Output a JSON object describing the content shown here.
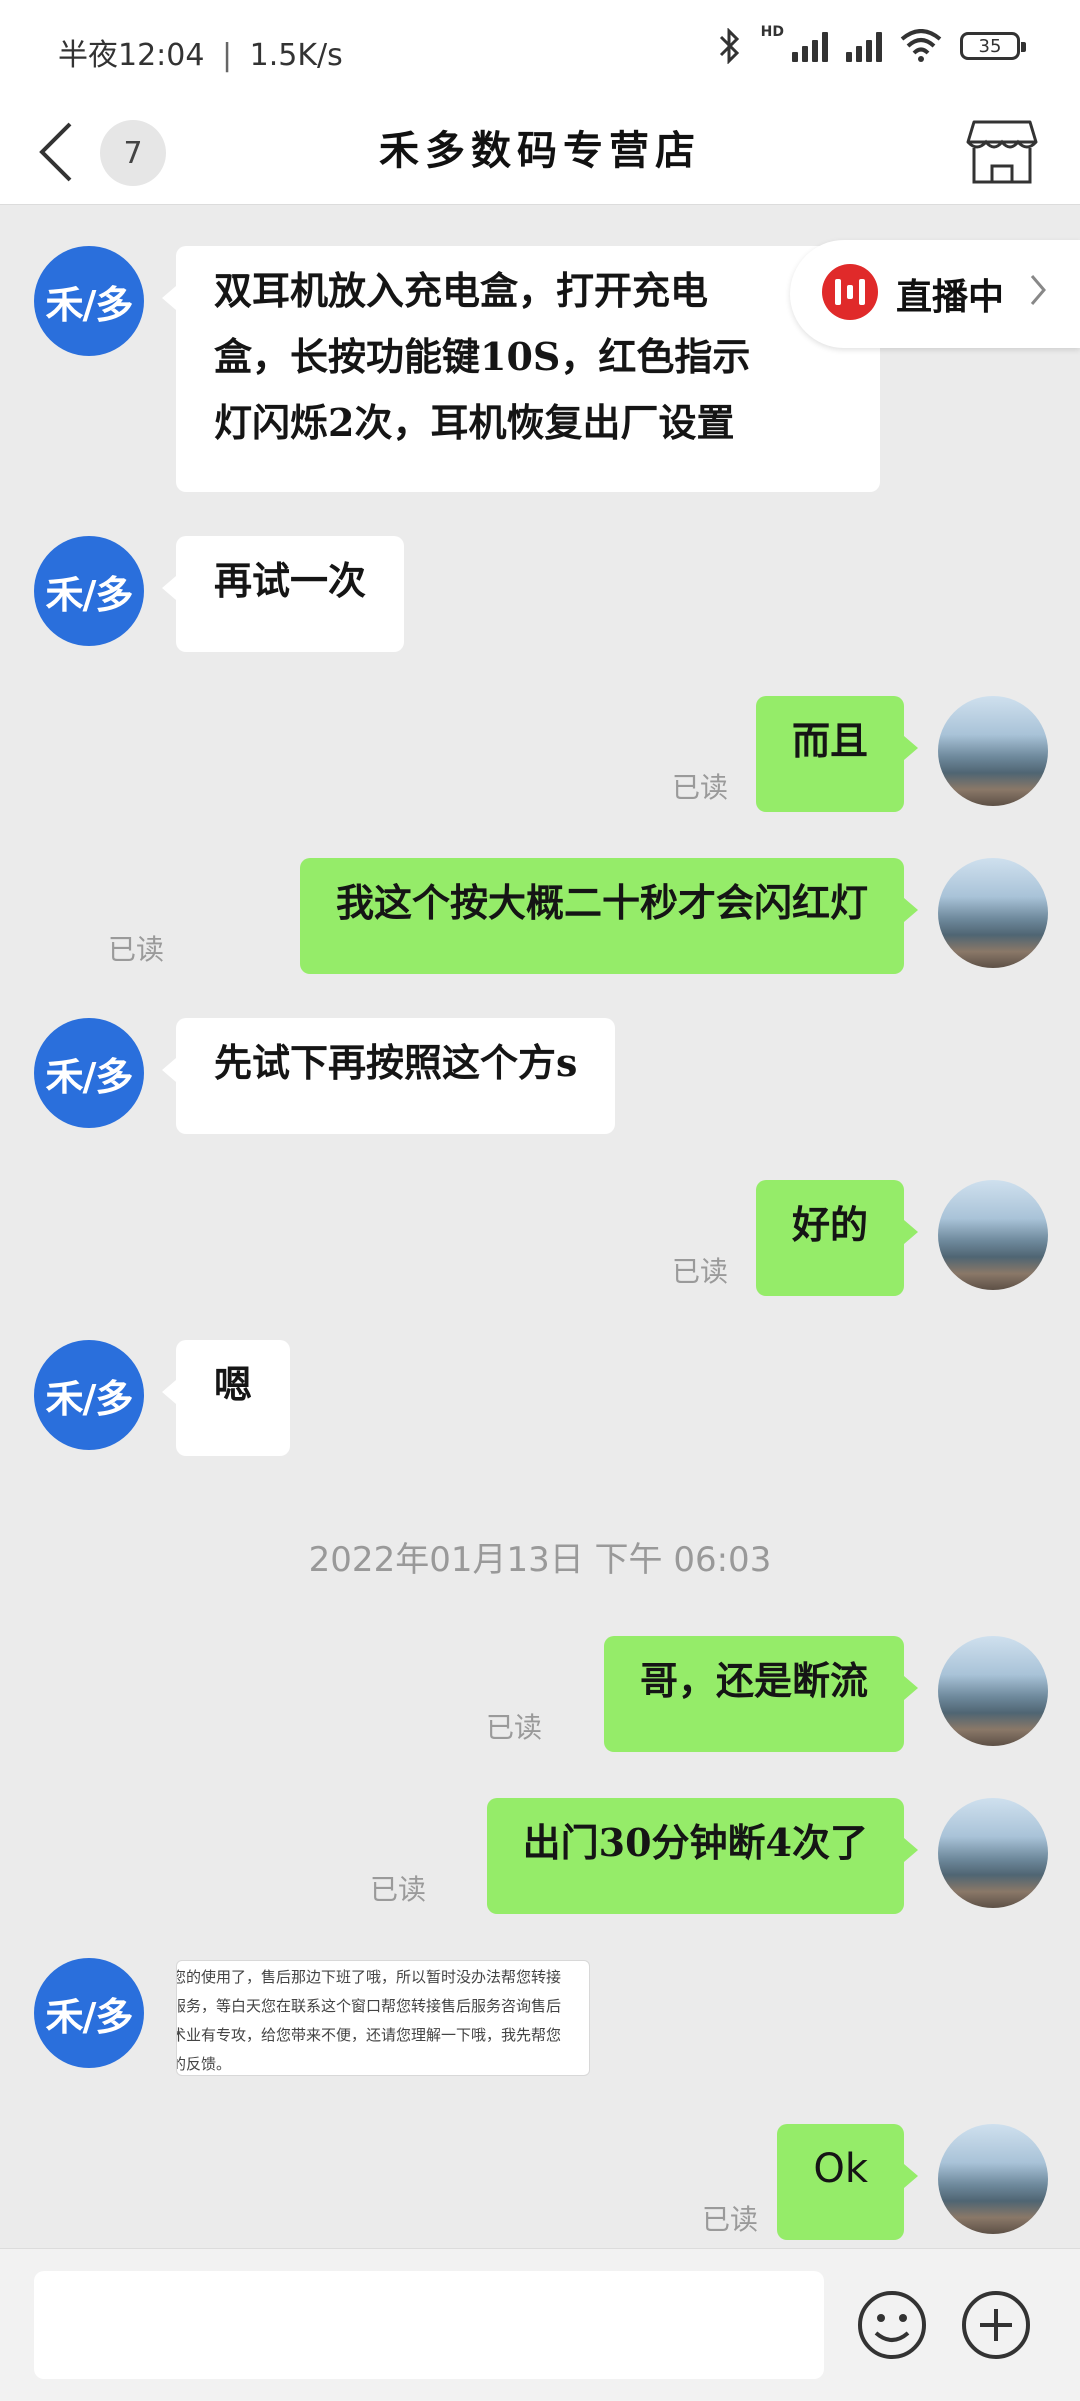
{
  "status_bar": {
    "time": "半夜12:04",
    "speed": "1.5K/s",
    "battery": "35",
    "network_badge": "HD"
  },
  "header": {
    "title": "禾多数码专营店",
    "unread_count": "7"
  },
  "live_badge": {
    "label": "直播中"
  },
  "shop_avatar_text": "禾/多",
  "read_label": "已读",
  "timestamp": "2022年01月13日  下午  06:03",
  "messages": [
    {
      "from": "shop",
      "lines": [
        "双耳机放入充电盒，打开充电",
        "盒，长按功能键10S，红色指示",
        "灯闪烁2次，耳机恢复出厂设置"
      ]
    },
    {
      "from": "shop",
      "text": "再试一次"
    },
    {
      "from": "user",
      "text": "而且"
    },
    {
      "from": "user",
      "text": "我这个按大概二十秒才会闪红灯"
    },
    {
      "from": "shop",
      "text": "先试下再按照这个方s"
    },
    {
      "from": "user",
      "text": "好的"
    },
    {
      "from": "shop",
      "text": "嗯"
    },
    {
      "from": "user",
      "text": "哥，还是断流"
    },
    {
      "from": "user",
      "text": "出门30分钟断4次了"
    },
    {
      "from": "shop",
      "image_lines": [
        "您的使用了，售后那边下班了哦，所以暂时没办法帮您转接",
        "服务，等白天您在联系这个窗口帮您转接售后服务咨询售后",
        "术业有专攻，给您带来不便，还请您理解一下哦，我先帮您",
        "的反馈。"
      ]
    },
    {
      "from": "user",
      "text": "Ok"
    }
  ],
  "icons": {
    "back": "chevron-left-icon",
    "shop": "store-icon",
    "emoji": "smiley-icon",
    "plus": "plus-circle-icon",
    "live": "live-stream-icon"
  },
  "colors": {
    "shop_avatar": "#2a6fdc",
    "out_bubble": "#95ec69",
    "in_bubble": "#ffffff",
    "live_icon": "#e02a2a"
  }
}
